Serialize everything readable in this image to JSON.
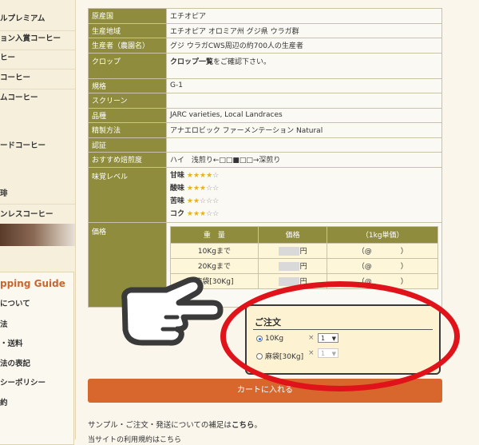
{
  "sidebar": {
    "items": [
      "ルプレミアム",
      "ョン入賞コーヒー",
      "ヒー",
      "コーヒー",
      "ムコーヒー",
      "ードコーヒー",
      "琲",
      "ンレスコーヒー"
    ],
    "shopping_title": "pping Guide",
    "shopping_items": [
      "について",
      "法",
      "・送料",
      "法の表記",
      "シーポリシー",
      "約"
    ]
  },
  "spec": {
    "rows": [
      {
        "key": "原産国",
        "value": "エチオピア"
      },
      {
        "key": "生産地域",
        "value": "エチオピア オロミア州 グジ県 ウラガ群"
      },
      {
        "key": "生産者（農園名）",
        "value": "グジ ウラガCWS周辺の約700人の生産者"
      },
      {
        "key": "クロップ",
        "value_bold": "クロップ一覧",
        "value": "をご確認下さい。"
      },
      {
        "key": "規格",
        "value": "G-1"
      },
      {
        "key": "スクリーン",
        "value": ""
      },
      {
        "key": "品種",
        "value": "JARC varieties, Local Landraces"
      },
      {
        "key": "精製方法",
        "value": "アナエロビック ファーメンテーション Natural"
      },
      {
        "key": "認証",
        "value": ""
      },
      {
        "key": "おすすめ焙煎度",
        "value": "ハイ　浅煎り←□□■□□→深煎り"
      }
    ],
    "taste_key": "味覚レベル",
    "taste": [
      {
        "label": "甘味",
        "full": "★★★★",
        "empty": "☆"
      },
      {
        "label": "酸味",
        "full": "★★★",
        "empty": "☆☆"
      },
      {
        "label": "苦味",
        "full": "★★",
        "empty": "☆☆☆"
      },
      {
        "label": "コク",
        "full": "★★★",
        "empty": "☆☆"
      }
    ],
    "price_key": "価格",
    "price_table": {
      "headers": [
        "重　量",
        "価格",
        "（1kg単価）"
      ],
      "rows": [
        {
          "weight": "10Kgまで",
          "price": "円",
          "unit": "（@　　　　）"
        },
        {
          "weight": "20Kgまで",
          "price": "円",
          "unit": "（@　　　　）"
        },
        {
          "weight": "麻袋[30Kg]",
          "price": "円",
          "unit": "（@　　　　）"
        }
      ]
    }
  },
  "order": {
    "title": "ご注文",
    "options": [
      {
        "label": "10Kg",
        "times": "×",
        "qty": "1",
        "selected": true
      },
      {
        "label": "麻袋[30Kg]",
        "times": "×",
        "qty": "1",
        "selected": false
      }
    ]
  },
  "cart_button": "カートに入れる",
  "note1_prefix": "サンプル・ご注文・発送についての補足は",
  "note1_link": "こちら",
  "note1_suffix": "。",
  "note2": "当サイトの利用規約はこちら",
  "colors": {
    "header_olive": "#8f8d3d",
    "accent_orange": "#d7672c",
    "highlight_red": "#e0131a"
  }
}
